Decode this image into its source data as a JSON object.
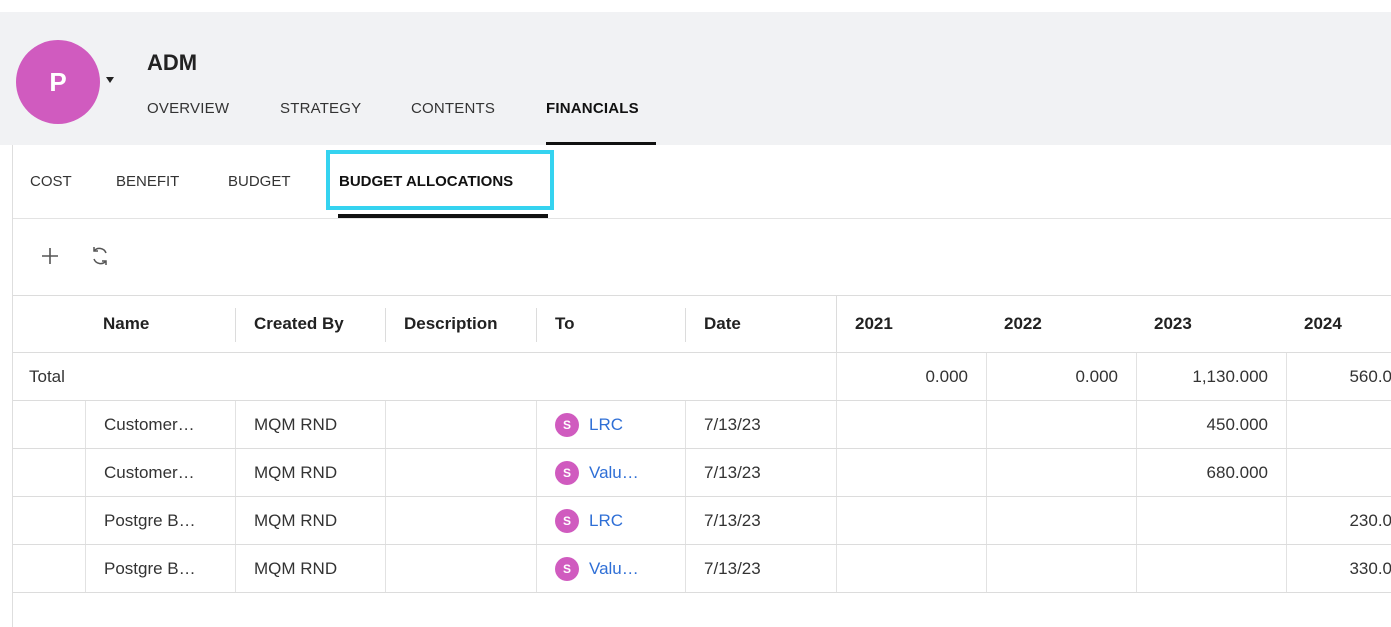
{
  "project": {
    "avatar_letter": "P",
    "title": "ADM",
    "color": "#d05bbf"
  },
  "nav": {
    "tabs": [
      {
        "label": "OVERVIEW",
        "active": false
      },
      {
        "label": "STRATEGY",
        "active": false
      },
      {
        "label": "CONTENTS",
        "active": false
      },
      {
        "label": "FINANCIALS",
        "active": true
      }
    ]
  },
  "sub_nav": {
    "tabs": [
      {
        "label": "COST",
        "active": false
      },
      {
        "label": "BENEFIT",
        "active": false
      },
      {
        "label": "BUDGET",
        "active": false
      },
      {
        "label": "BUDGET ALLOCATIONS",
        "active": true
      }
    ],
    "highlight_color": "#35d3f0"
  },
  "toolbar": {
    "add_icon": "plus-icon",
    "refresh_icon": "refresh-icon"
  },
  "table": {
    "columns": [
      "Name",
      "Created By",
      "Description",
      "To",
      "Date",
      "2021",
      "2022",
      "2023",
      "2024"
    ],
    "total": {
      "label": "Total",
      "y2021": "0.000",
      "y2022": "0.000",
      "y2023": "1,130.000",
      "y2024": "560.0"
    },
    "rows": [
      {
        "name": "Customer…",
        "created_by": "MQM RND",
        "description": "",
        "to_badge": "S",
        "to": "LRC",
        "date": "7/13/23",
        "y2021": "",
        "y2022": "",
        "y2023": "450.000",
        "y2024": ""
      },
      {
        "name": "Customer…",
        "created_by": "MQM RND",
        "description": "",
        "to_badge": "S",
        "to": "Valu…",
        "date": "7/13/23",
        "y2021": "",
        "y2022": "",
        "y2023": "680.000",
        "y2024": ""
      },
      {
        "name": "Postgre B…",
        "created_by": "MQM RND",
        "description": "",
        "to_badge": "S",
        "to": "LRC",
        "date": "7/13/23",
        "y2021": "",
        "y2022": "",
        "y2023": "",
        "y2024": "230.0"
      },
      {
        "name": "Postgre B…",
        "created_by": "MQM RND",
        "description": "",
        "to_badge": "S",
        "to": "Valu…",
        "date": "7/13/23",
        "y2021": "",
        "y2022": "",
        "y2023": "",
        "y2024": "330.0"
      }
    ]
  }
}
